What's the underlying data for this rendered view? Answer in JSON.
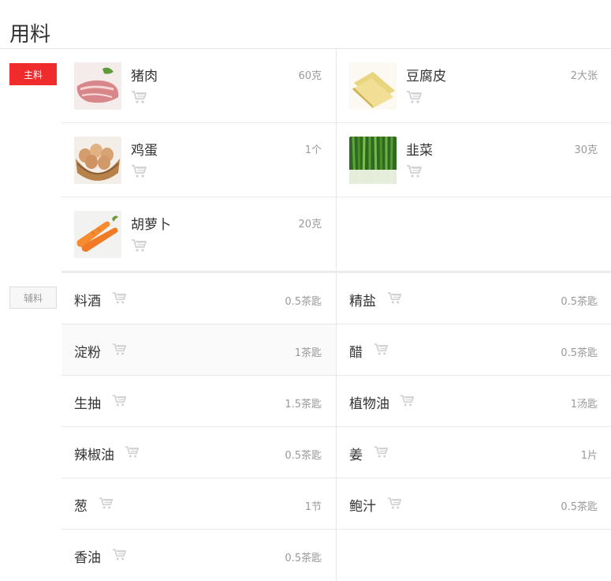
{
  "page": {
    "title": "用料"
  },
  "main_label": "主料",
  "aux_label": "辅料",
  "main_items": [
    {
      "name": "猪肉",
      "amount": "60克",
      "image": "pork"
    },
    {
      "name": "豆腐皮",
      "amount": "2大张",
      "image": "tofu-skin"
    },
    {
      "name": "鸡蛋",
      "amount": "1个",
      "image": "eggs"
    },
    {
      "name": "韭菜",
      "amount": "30克",
      "image": "chives"
    },
    {
      "name": "胡萝卜",
      "amount": "20克",
      "image": "carrot"
    }
  ],
  "aux_items": [
    {
      "name": "料酒",
      "amount": "0.5茶匙"
    },
    {
      "name": "精盐",
      "amount": "0.5茶匙"
    },
    {
      "name": "淀粉",
      "amount": "1茶匙"
    },
    {
      "name": "醋",
      "amount": "0.5茶匙"
    },
    {
      "name": "生抽",
      "amount": "1.5茶匙"
    },
    {
      "name": "植物油",
      "amount": "1汤匙"
    },
    {
      "name": "辣椒油",
      "amount": "0.5茶匙"
    },
    {
      "name": "姜",
      "amount": "1片"
    },
    {
      "name": "葱",
      "amount": "1节"
    },
    {
      "name": "鲍汁",
      "amount": "0.5茶匙"
    },
    {
      "name": "香油",
      "amount": "0.5茶匙"
    }
  ],
  "colors": {
    "accent": "#f02b2b",
    "muted": "#999999",
    "icon": "#cccccc"
  },
  "icons": {
    "cart": "shopping-cart-icon"
  }
}
